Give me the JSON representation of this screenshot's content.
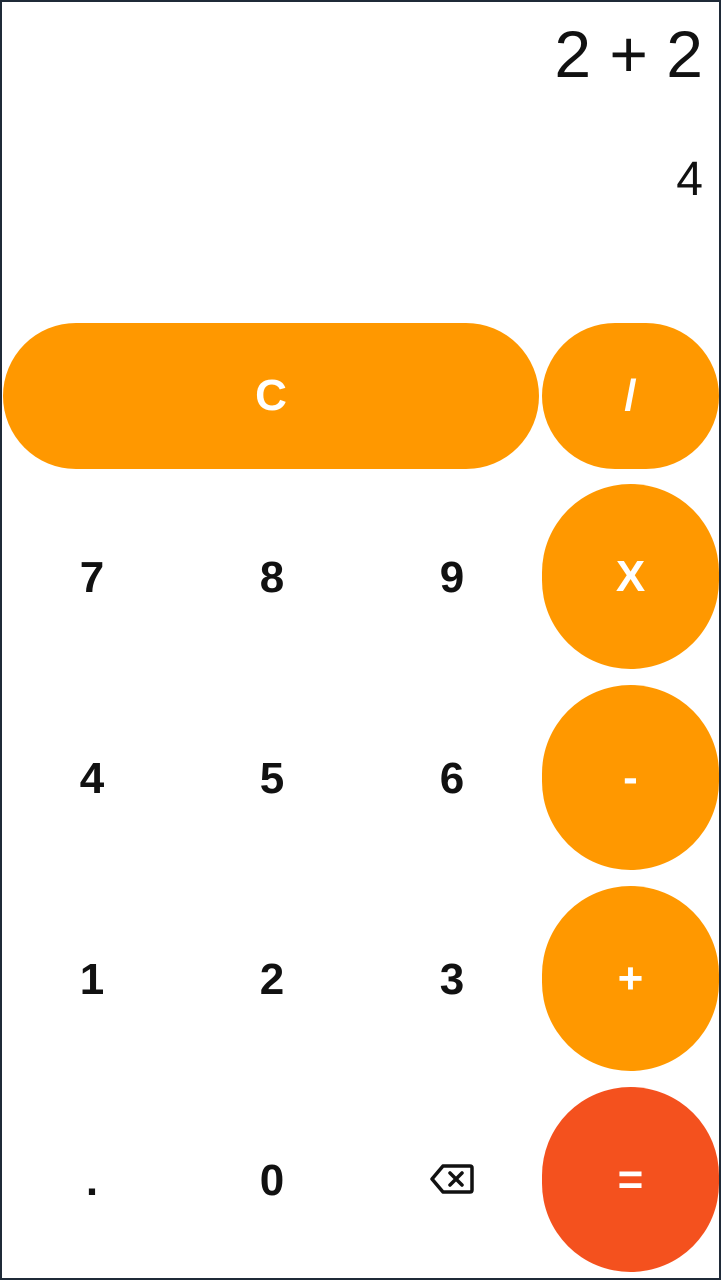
{
  "display": {
    "expression": "2 + 2",
    "result": "4"
  },
  "keys": {
    "clear": "C",
    "divide": "/",
    "multiply": "X",
    "subtract": "-",
    "add": "+",
    "equals": "=",
    "seven": "7",
    "eight": "8",
    "nine": "9",
    "four": "4",
    "five": "5",
    "six": "6",
    "one": "1",
    "two": "2",
    "three": "3",
    "decimal": ".",
    "zero": "0",
    "backspace_icon": "backspace-icon"
  },
  "colors": {
    "operator": "#ff9800",
    "equals": "#f4511e",
    "text": "#111111",
    "operator_text": "#ffffff"
  }
}
